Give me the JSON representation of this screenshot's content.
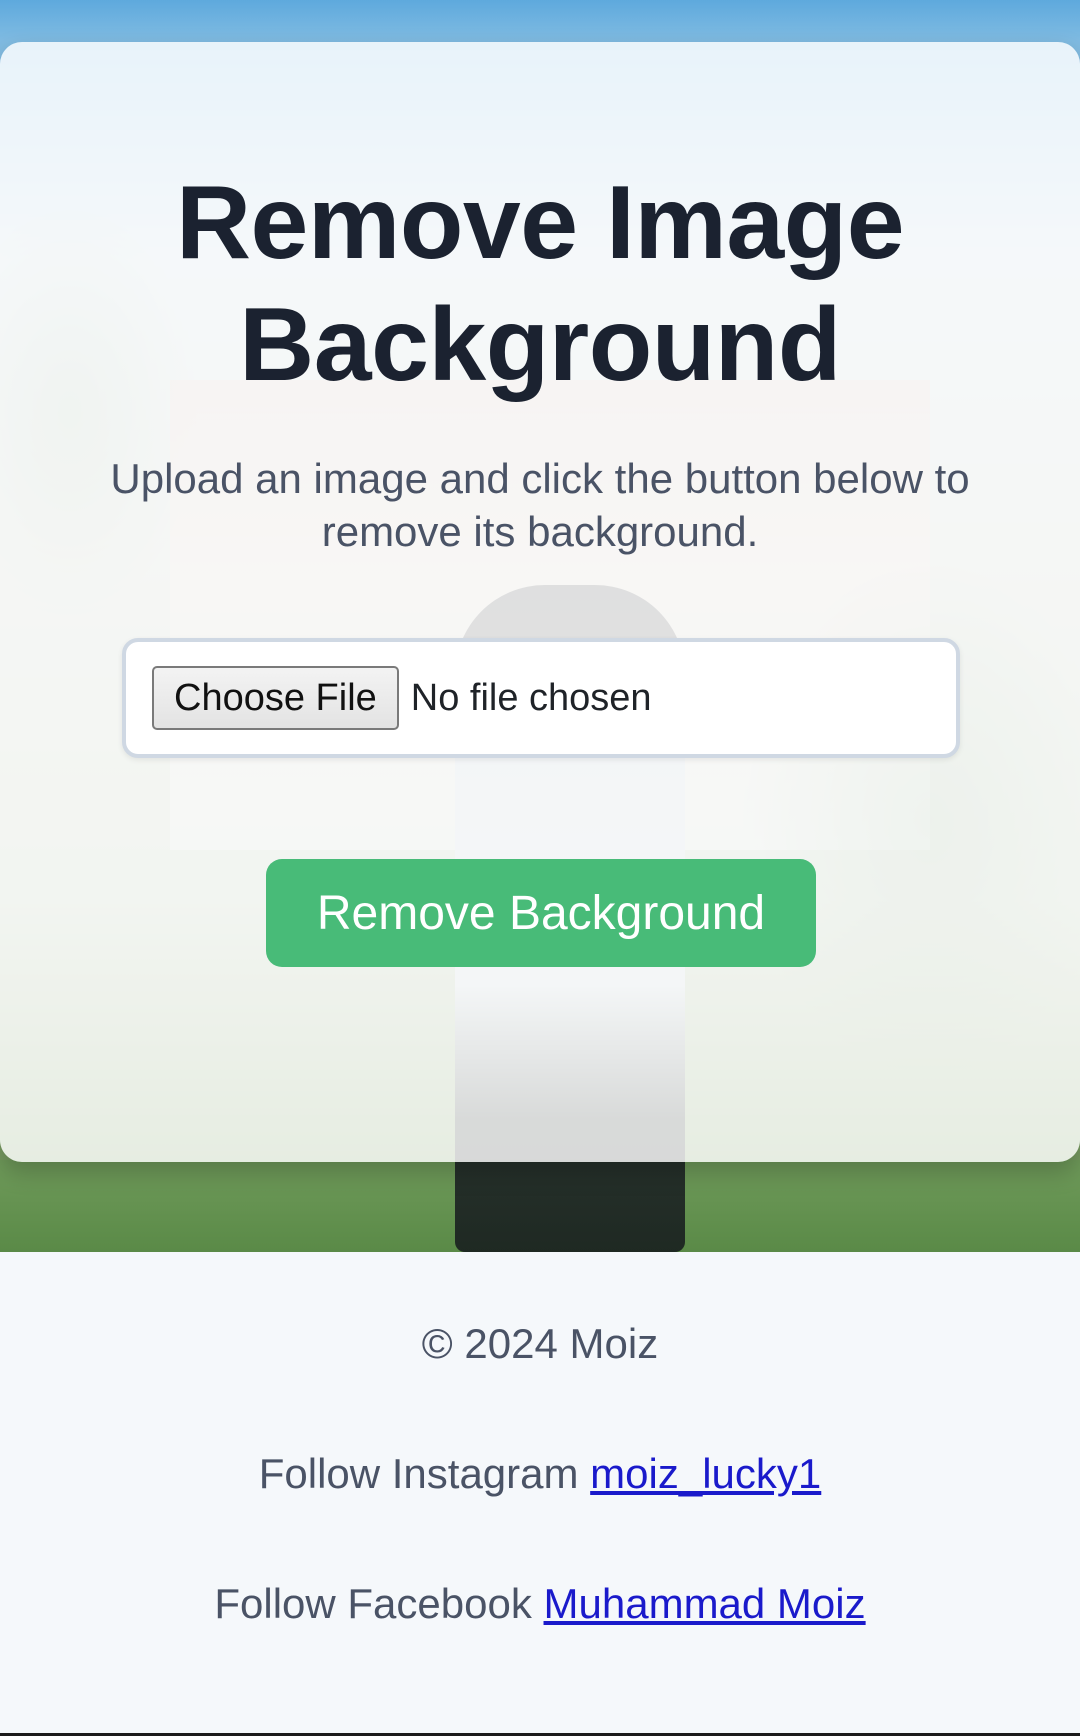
{
  "card": {
    "title": "Remove Image Background",
    "subtitle": "Upload an image and click the button below to remove its background.",
    "file_button_label": "Choose File",
    "file_status": "No file chosen",
    "remove_button_label": "Remove Background"
  },
  "footer": {
    "copyright": "© 2024 Moiz",
    "instagram_prefix": "Follow Instagram",
    "instagram_handle": "moiz_lucky1",
    "facebook_prefix": "Follow Facebook",
    "facebook_name": "Muhammad Moiz"
  },
  "colors": {
    "accent_button": "#48bb78",
    "title_text": "#1b2230",
    "link": "#1a1acb"
  }
}
